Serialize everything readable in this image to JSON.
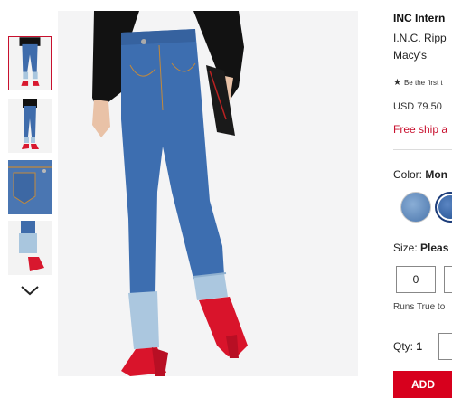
{
  "product": {
    "brand": "INC Intern",
    "name_line1": "I.N.C. Ripp",
    "name_line2": "Macy's",
    "review_star": "★",
    "review_text": "Be the first t",
    "price": "USD 79.50",
    "shipping": "Free ship a"
  },
  "color": {
    "label": "Color:",
    "selected": "Mon",
    "swatches": [
      {
        "name": "light wash",
        "hex": "#7fa3cf"
      },
      {
        "name": "medium wash",
        "hex": "#3f6cab"
      }
    ]
  },
  "size": {
    "label": "Size:",
    "prompt": "Pleas",
    "options": [
      "0",
      ""
    ],
    "fit_text": "Runs True to"
  },
  "quantity": {
    "label": "Qty:",
    "value": "1"
  },
  "cart": {
    "add_label": "ADD"
  },
  "gallery": {
    "thumbnails": [
      "front view",
      "side view",
      "pocket detail",
      "cuff detail"
    ],
    "active_index": 0,
    "scroll_icon": "chevron-down-icon"
  },
  "colors": {
    "brand_red": "#c8102e",
    "button_red": "#d7001d",
    "denim": "#3f6cab"
  }
}
